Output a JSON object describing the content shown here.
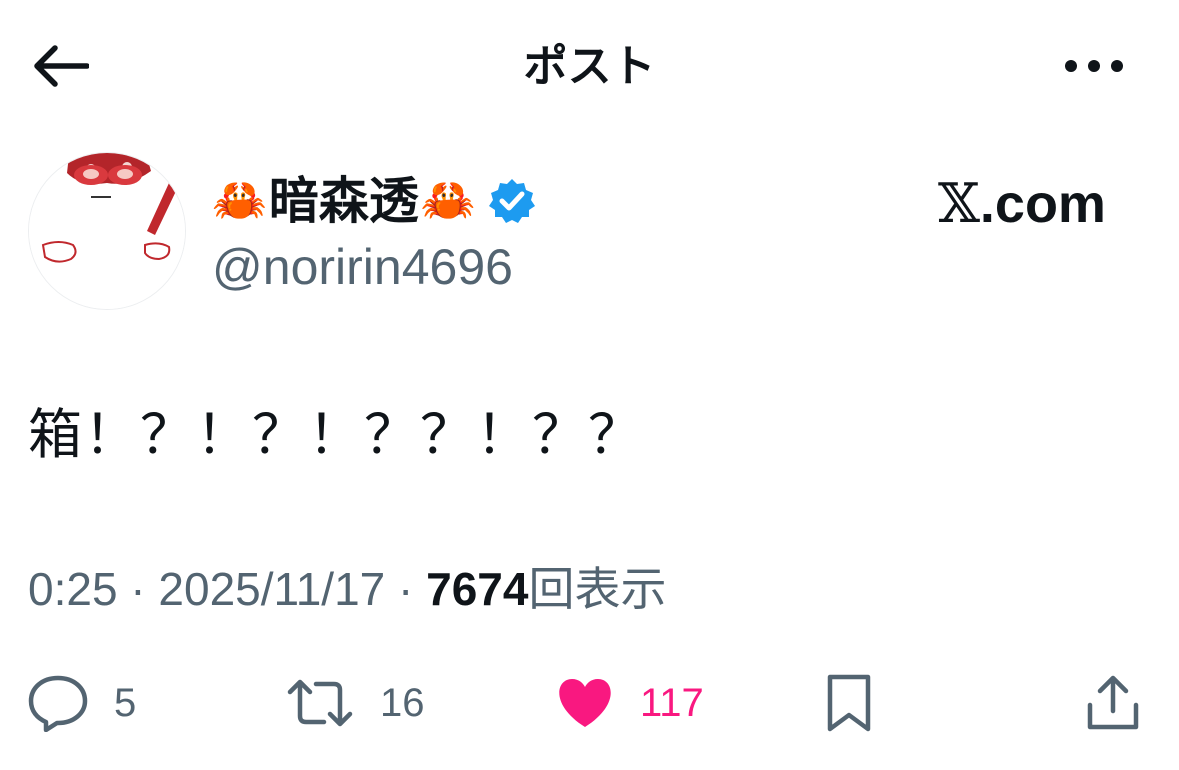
{
  "header": {
    "title": "ポスト",
    "back_icon": "arrow-left-icon",
    "more_icon": "more-horizontal-icon"
  },
  "author": {
    "name_prefix_emoji": "🦀",
    "name": "暗森透",
    "name_suffix_emoji": "🦀",
    "verified_icon": "verified-badge-icon",
    "handle": "@noririn4696",
    "avatar_icon": "avatar-illustration"
  },
  "source": {
    "logo": "𝕏",
    "suffix": ".com"
  },
  "post": {
    "text": "箱！？！？！？？！？？"
  },
  "meta": {
    "time": "0:25",
    "separator": " · ",
    "date": "2025/11/17",
    "views": "7674",
    "views_label": "回表示"
  },
  "actions": {
    "replies": "5",
    "reposts": "16",
    "likes": "117",
    "liked": true,
    "reply_icon": "reply-bubble-icon",
    "repost_icon": "repost-icon",
    "like_icon": "heart-icon",
    "bookmark_icon": "bookmark-icon",
    "share_icon": "share-icon"
  },
  "colors": {
    "text_primary": "#0f1419",
    "text_secondary": "#536471",
    "like_pink": "#f91880",
    "verified_blue": "#1d9bf0"
  }
}
